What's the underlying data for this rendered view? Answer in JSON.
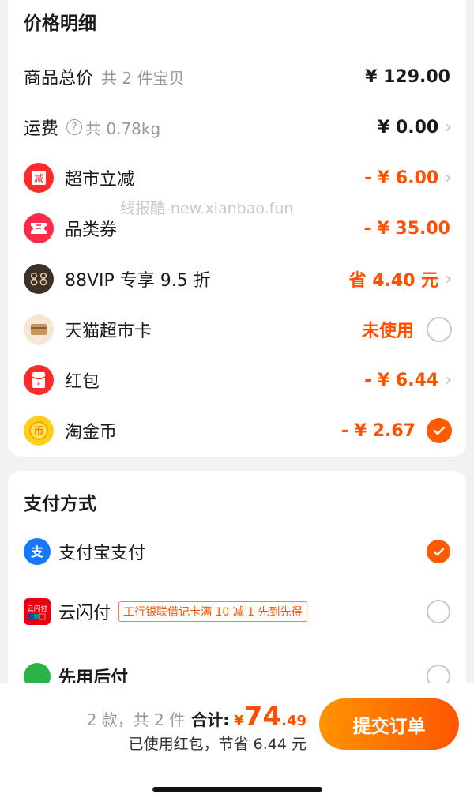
{
  "price_section": {
    "title": "价格明细",
    "goods": {
      "label": "商品总价",
      "sub": "共 2 件宝贝",
      "value": "¥ 129.00"
    },
    "shipping": {
      "label": "运费",
      "sub": "共 0.78kg",
      "value": "¥ 0.00"
    },
    "items": [
      {
        "label": "超市立减",
        "value": "- ¥ 6.00",
        "icon": "reduce-icon",
        "trail": "chevron"
      },
      {
        "label": "品类券",
        "value": "- ¥ 35.00",
        "icon": "coupon-icon",
        "trail": "none"
      },
      {
        "label": "88VIP 专享 9.5 折",
        "value": "省 4.40 元",
        "icon": "vip88-icon",
        "trail": "chevron"
      },
      {
        "label": "天猫超市卡",
        "value": "未使用",
        "icon": "card-icon",
        "trail": "radio"
      },
      {
        "label": "红包",
        "value": "- ¥ 6.44",
        "icon": "red-packet-icon",
        "trail": "chevron"
      },
      {
        "label": "淘金币",
        "value": "- ¥ 2.67",
        "icon": "gold-coin-icon",
        "trail": "checked"
      }
    ]
  },
  "watermark": "线报酷-new.xianbao.fun",
  "payment_section": {
    "title": "支付方式",
    "methods": [
      {
        "label": "支付宝支付",
        "checked": true,
        "icon": "alipay-icon"
      },
      {
        "label": "云闪付",
        "promo": "工行银联借记卡满 10 减 1 先到先得",
        "checked": false,
        "icon": "unionpay-icon"
      },
      {
        "label": "先用后付",
        "checked": false,
        "icon": "pay-later-icon"
      }
    ]
  },
  "bottom": {
    "count": "2 款，共 2 件",
    "total_label": "合计:",
    "currency": "¥",
    "total_int": "74",
    "total_dec": ".49",
    "saved": "已使用红包，节省 6.44 元",
    "submit": "提交订单"
  },
  "colors": {
    "accent": "#ff5000",
    "button_start": "#ff9400",
    "button_end": "#ff5500"
  }
}
